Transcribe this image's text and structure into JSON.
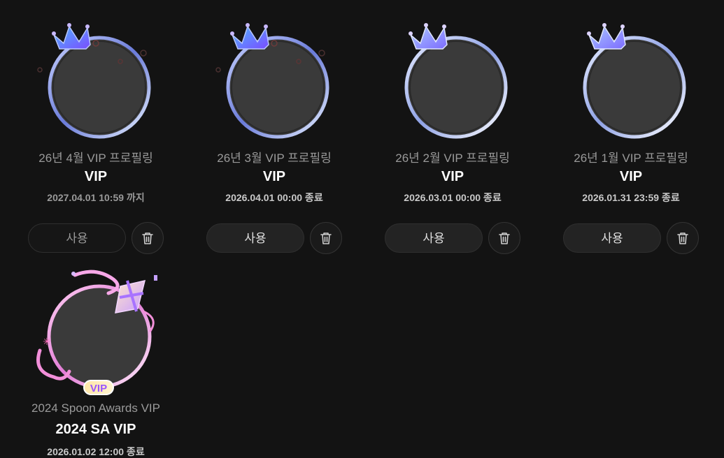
{
  "items": [
    {
      "subtitle": "26년 4월 VIP 프로필링",
      "title": "VIP",
      "period": "2027.04.01 10:59 까지",
      "use_label": "사용",
      "delete_icon": "trash-icon",
      "frame": "crown-vip-frame"
    },
    {
      "subtitle": "26년 3월 VIP 프로필링",
      "title": "VIP",
      "period": "2026.04.01 00:00 종료",
      "use_label": "사용",
      "delete_icon": "trash-icon",
      "frame": "crown-vip-frame"
    },
    {
      "subtitle": "26년 2월 VIP 프로필링",
      "title": "VIP",
      "period": "2026.03.01 00:00 종료",
      "use_label": "사용",
      "delete_icon": "trash-icon",
      "frame": "crown-vip-frame"
    },
    {
      "subtitle": "26년 1월 VIP 프로필링",
      "title": "VIP",
      "period": "2026.01.31 23:59 종료",
      "use_label": "사용",
      "delete_icon": "trash-icon",
      "frame": "crown-vip-frame"
    },
    {
      "subtitle": "2024 Spoon Awards VIP",
      "title": "2024 SA VIP",
      "period": "2026.01.02 12:00 종료",
      "badge": "VIP",
      "frame": "spoon-awards-gift-frame"
    }
  ],
  "colors": {
    "background": "#131313",
    "button": "#232323",
    "crown_purple": "#7c5cff",
    "awards_pink": "#f0a6e6"
  }
}
